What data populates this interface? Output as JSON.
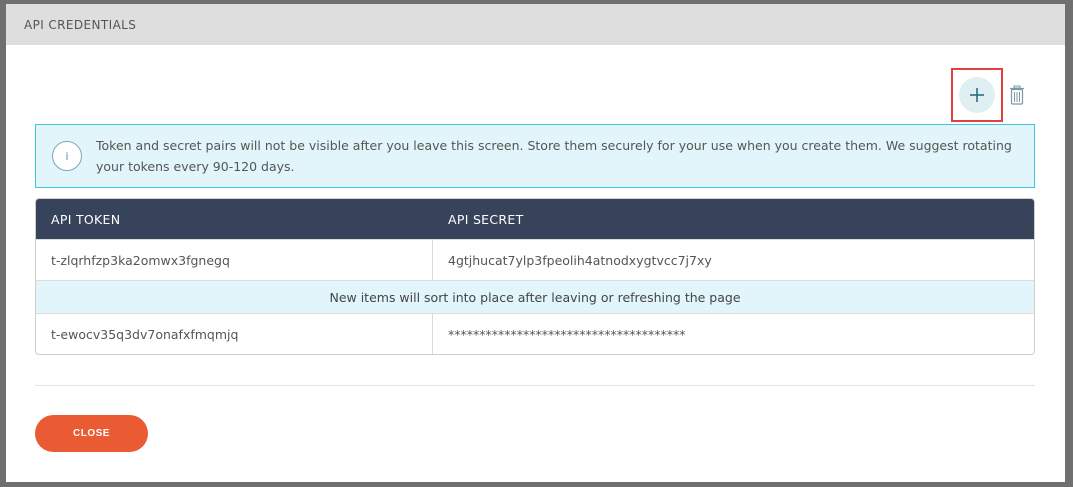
{
  "modal": {
    "title": "API CREDENTIALS"
  },
  "actions": {
    "add_icon": "plus-icon",
    "delete_icon": "trash-icon"
  },
  "info": {
    "icon": "i",
    "text": "Token and secret pairs will not be visible after you leave this screen. Store them securely for your use when you create them. We suggest rotating your tokens every 90-120 days."
  },
  "table": {
    "headers": [
      "API TOKEN",
      "API SECRET"
    ],
    "rows": [
      {
        "token": "t-zlqrhfzp3ka2omwx3fgnegq",
        "secret": "4gtjhucat7ylp3fpeolih4atnodxygtvcc7j7xy"
      },
      {
        "token": "t-ewocv35q3dv7onafxfmqmjq",
        "secret": "**************************************"
      }
    ],
    "notice": "New items will sort into place after leaving or refreshing the page"
  },
  "footer": {
    "close_label": "CLOSE"
  },
  "colors": {
    "header_bg": "#37435a",
    "info_bg": "#e1f5fb",
    "info_border": "#3ec5d8",
    "close_button": "#ea5a33",
    "highlight": "#e04040"
  }
}
